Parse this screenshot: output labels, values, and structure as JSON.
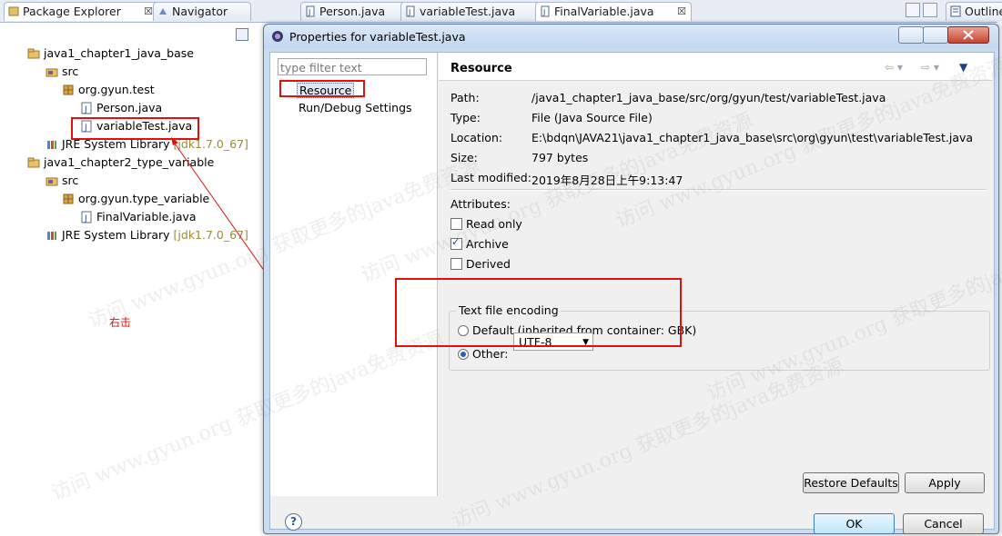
{
  "tabs": {
    "package_explorer": "Package Explorer",
    "navigator": "Navigator",
    "person": "Person.java",
    "variable_test": "variableTest.java",
    "final_variable": "FinalVariable.java",
    "outline": "Outline",
    "close_glyph": "☒"
  },
  "explorer": {
    "items": [
      {
        "label": "java1_chapter1_java_base",
        "icon": "project-icon"
      },
      {
        "label": "src",
        "icon": "source-folder-icon"
      },
      {
        "label": "org.gyun.test",
        "icon": "package-icon"
      },
      {
        "label": "Person.java",
        "icon": "java-file-icon"
      },
      {
        "label": "variableTest.java",
        "icon": "java-file-icon"
      },
      {
        "label": "JRE System Library",
        "note": "[jdk1.7.0_67]",
        "icon": "library-icon"
      },
      {
        "label": "java1_chapter2_type_variable",
        "icon": "project-icon"
      },
      {
        "label": "src",
        "icon": "source-folder-icon"
      },
      {
        "label": "org.gyun.type_variable",
        "icon": "package-icon"
      },
      {
        "label": "FinalVariable.java",
        "icon": "java-file-icon"
      },
      {
        "label": "JRE System Library",
        "note": "[jdk1.7.0_67]",
        "icon": "library-icon"
      }
    ],
    "annotation": "右击"
  },
  "dialog": {
    "title": "Properties for variableTest.java",
    "filter_placeholder": "type filter text",
    "nav_items": [
      "Resource",
      "Run/Debug Settings"
    ],
    "section_title": "Resource",
    "props": [
      {
        "label": "Path:",
        "value": "/java1_chapter1_java_base/src/org/gyun/test/variableTest.java"
      },
      {
        "label": "Type:",
        "value": "File  (Java Source File)"
      },
      {
        "label": "Location:",
        "value": "E:\\bdqn\\JAVA21\\java1_chapter1_java_base\\src\\org\\gyun\\test\\variableTest.java"
      },
      {
        "label": "Size:",
        "value": "797  bytes"
      },
      {
        "label": "Last modified:",
        "value": "2019年8月28日上午9:13:47"
      }
    ],
    "attributes_label": "Attributes:",
    "checkboxes": [
      {
        "label": "Read only",
        "checked": false
      },
      {
        "label": "Archive",
        "checked": true
      },
      {
        "label": "Derived",
        "checked": false
      }
    ],
    "encoding": {
      "group_title": "Text file encoding",
      "default_label": "Default (inherited from container: GBK)",
      "other_label": "Other:",
      "other_value": "UTF-8",
      "selected": "other"
    },
    "buttons": {
      "restore": "Restore Defaults",
      "apply": "Apply",
      "ok": "OK",
      "cancel": "Cancel",
      "help": "?"
    }
  },
  "watermark": "访问 www.gyun.org 获取更多的java免费资源",
  "colors": {
    "annotation_red": "#e01010",
    "dialog_frame": "#c9dcf1"
  }
}
